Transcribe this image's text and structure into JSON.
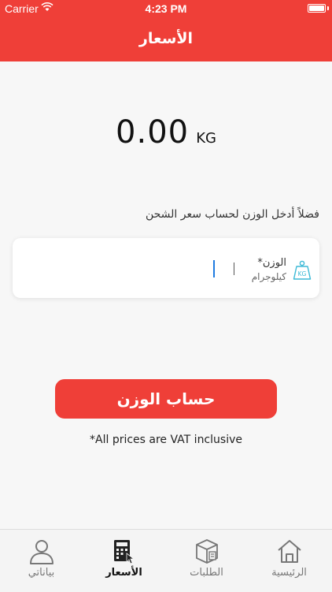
{
  "status_bar": {
    "carrier": "Carrier",
    "time": "4:23 PM"
  },
  "header": {
    "title": "الأسعار"
  },
  "weight_display": {
    "value": "0.00",
    "unit": "KG"
  },
  "instruction": "فضلاً أدخل الوزن لحساب سعر الشحن",
  "weight_field": {
    "label": "الوزن*",
    "sublabel": "كيلوجرام",
    "icon_text": "KG",
    "value": ""
  },
  "calculate_button": {
    "label": "حساب الوزن"
  },
  "vat_note": "*All prices are VAT inclusive",
  "tabs": [
    {
      "label": "بياناتي",
      "icon": "user-icon"
    },
    {
      "label": "الأسعار",
      "icon": "calculator-icon",
      "active": true
    },
    {
      "label": "الطلبات",
      "icon": "box-icon"
    },
    {
      "label": "الرئيسية",
      "icon": "home-icon"
    }
  ],
  "colors": {
    "brand": "#ef3f38",
    "caret": "#1e7be0",
    "icon_accent": "#3bb9d6"
  }
}
